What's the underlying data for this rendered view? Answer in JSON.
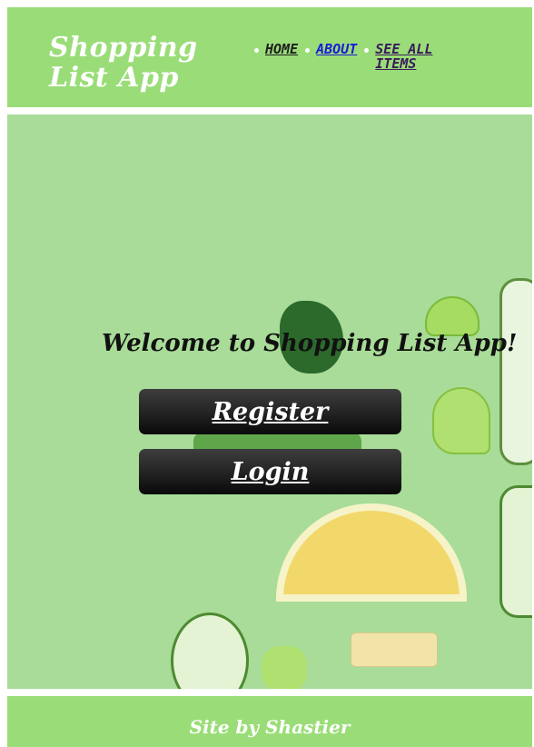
{
  "header": {
    "title": "Shopping List App",
    "nav": {
      "home": "Home",
      "about": "About",
      "see_all_items": "See All Items"
    }
  },
  "hero": {
    "welcome": "Welcome to Shopping List App!",
    "background_image": "vegetables-on-green-background",
    "buttons": {
      "register": "Register",
      "login": "Login"
    }
  },
  "footer": {
    "credit": "Site by Shastier"
  },
  "colors": {
    "header_bg": "#9add78",
    "hero_bg": "#a8dc98",
    "button_dark": "#111111",
    "nav_about": "#1b1bd6"
  }
}
